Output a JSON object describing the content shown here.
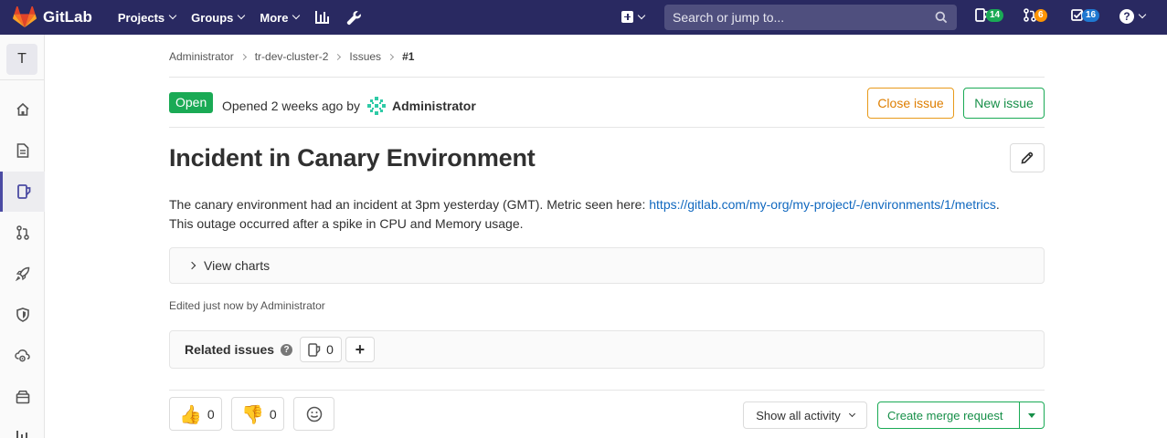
{
  "navbar": {
    "brand": "GitLab",
    "menu": [
      {
        "label": "Projects"
      },
      {
        "label": "Groups"
      },
      {
        "label": "More"
      }
    ],
    "search_placeholder": "Search or jump to...",
    "issues_count": "14",
    "merge_requests_count": "6",
    "todos_count": "16",
    "help_glyph": "?",
    "colors": {
      "background": "#292961",
      "issues_badge": "#1aaa55",
      "mr_badge": "#fc9403",
      "todos_badge": "#1f78d1"
    }
  },
  "sidebar": {
    "project_initial": "T",
    "items": [
      {
        "icon": "home-icon"
      },
      {
        "icon": "document-icon"
      },
      {
        "icon": "issues-icon",
        "active": true
      },
      {
        "icon": "merge-request-icon"
      },
      {
        "icon": "rocket-icon"
      },
      {
        "icon": "shield-icon"
      },
      {
        "icon": "cloud-gear-icon"
      },
      {
        "icon": "package-icon"
      }
    ]
  },
  "breadcrumb": [
    "Administrator",
    "tr-dev-cluster-2",
    "Issues",
    "#1"
  ],
  "issue": {
    "status": "Open",
    "opened_text": "Opened 2 weeks ago by",
    "author": "Administrator",
    "close_label": "Close issue",
    "new_label": "New issue",
    "title": "Incident in Canary Environment",
    "description_prefix": "The canary environment had an incident at 3pm yesterday (GMT). Metric seen here: ",
    "description_link": "https://gitlab.com/my-org/my-project/-/environments/1/metrics",
    "description_suffix": ".",
    "description_line2": "This outage occurred after a spike in CPU and Memory usage.",
    "details_label": "View charts",
    "edited_text": "Edited just now by Administrator"
  },
  "related": {
    "title": "Related issues",
    "help_glyph": "?",
    "count": "0",
    "add_glyph": "+"
  },
  "awards": {
    "thumbs_up_emoji": "👍",
    "thumbs_up_count": "0",
    "thumbs_down_emoji": "👎",
    "thumbs_down_count": "0"
  },
  "actions": {
    "activity_label": "Show all activity",
    "merge_request_label": "Create merge request"
  }
}
